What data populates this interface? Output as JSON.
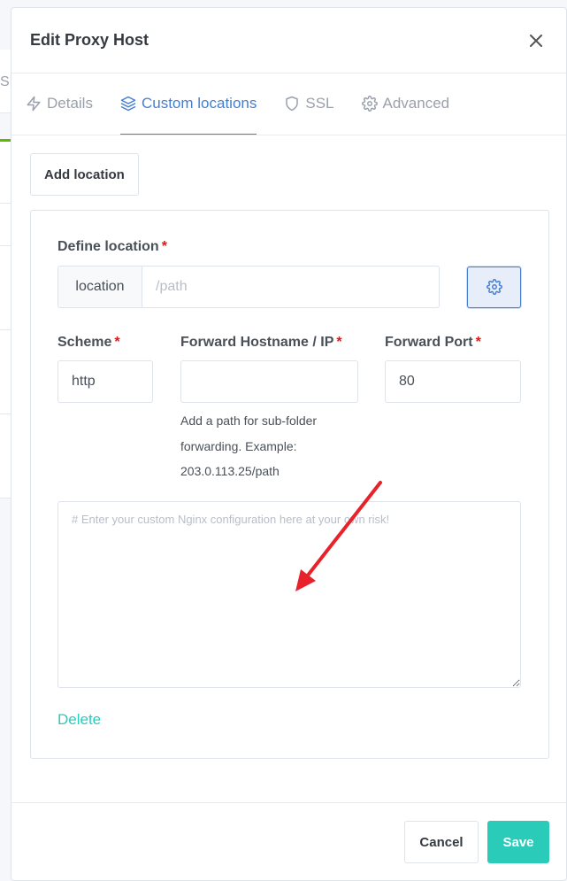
{
  "background": {
    "tab_fragment": "SL"
  },
  "modal": {
    "title": "Edit Proxy Host",
    "tabs": [
      {
        "label": "Details",
        "icon": "lightning-icon",
        "active": false
      },
      {
        "label": "Custom locations",
        "icon": "layers-icon",
        "active": true
      },
      {
        "label": "SSL",
        "icon": "shield-icon",
        "active": false
      },
      {
        "label": "Advanced",
        "icon": "gear-icon",
        "active": false
      }
    ]
  },
  "body": {
    "add_location_label": "Add location",
    "location": {
      "define_label": "Define location",
      "required_mark": "*",
      "addon": "location",
      "path_placeholder": "/path",
      "path_value": ""
    },
    "scheme": {
      "label": "Scheme",
      "value": "http"
    },
    "forward_host": {
      "label": "Forward Hostname / IP",
      "value": "",
      "help": "Add a path for sub-folder forwarding. Example: 203.0.113.25/path"
    },
    "forward_port": {
      "label": "Forward Port",
      "value": "80"
    },
    "custom_config": {
      "placeholder": "# Enter your custom Nginx configuration here at your own risk!",
      "value": ""
    },
    "delete_label": "Delete"
  },
  "footer": {
    "cancel_label": "Cancel",
    "save_label": "Save"
  },
  "colors": {
    "primary": "#467fcf",
    "teal": "#2bcbba",
    "required": "#cd201f",
    "annotation_arrow": "#e8222a"
  }
}
